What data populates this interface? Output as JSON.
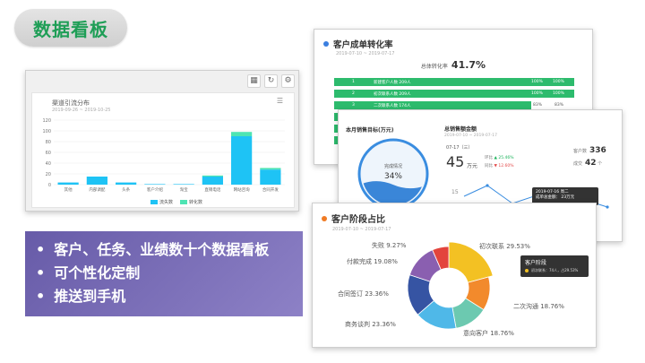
{
  "page_title": "数据看板",
  "bullets": [
    "客户、任务、业绩数十个数据看板",
    "可个性化定制",
    "推送到手机"
  ],
  "panel_channel": {
    "title": "渠道引流分布",
    "date": "2019-09-26 ~ 2019-10-25",
    "toolbar_icons": [
      "calendar-icon",
      "refresh-icon",
      "gear-icon"
    ],
    "legend": [
      "流失数",
      "转化数"
    ],
    "colors": {
      "loss": "#1ec3f5",
      "convert": "#4ee4b3"
    }
  },
  "panel_conversion": {
    "title": "客户成单转化率",
    "date": "2019-07-10 ~ 2019-07-17",
    "rate_label": "总体转化率",
    "rate_value": "41.7%",
    "accent": "#3a7fe0",
    "rows": [
      {
        "num": "1",
        "label": "新建客户人数 209人",
        "pct1": "100%",
        "pct2": "100%"
      },
      {
        "num": "2",
        "label": "初次联系人数 209人",
        "pct1": "100%",
        "pct2": "100%"
      },
      {
        "num": "3",
        "label": "二次联系人数 174人",
        "pct1": "83%",
        "pct2": "83%"
      }
    ]
  },
  "panel_sales": {
    "target_title": "本月销售目标(万元)",
    "total_title": "总销售额金额",
    "total_date": "2019-07-10 ~ 2019-07-17",
    "donut_label": "完成情况",
    "donut_value": "34%",
    "donut_fraction": 0.34,
    "date_label": "07-17（三）",
    "big_value": "45",
    "big_unit": "万元",
    "cmp_prev_label": "环比",
    "cmp_prev_value": "▲ 25.46%",
    "cmp_year_label": "同比",
    "cmp_year_value": "▼ 12.60%",
    "side1_label": "客户数",
    "side1_value": "336",
    "side2_label": "成交",
    "side2_value": "42",
    "side2_unit": "个",
    "y_ticks": [
      "15",
      "10",
      "5"
    ],
    "tip_date": "2019-07-16 周二",
    "tip_value": "成单总金额：  23万元"
  },
  "panel_stage": {
    "title": "客户阶段占比",
    "date": "2019-07-10 ~ 2019-07-17",
    "accent": "#f07b24",
    "tooltip_title": "客户阶段",
    "tooltip_sub": "初次联系：74人，占29.53%",
    "slices": [
      {
        "name": "初次联系",
        "pct": 29.53,
        "label": "初次联系 29.53%",
        "color": "#f3c123"
      },
      {
        "name": "二次沟通",
        "pct": 18.76,
        "label": "二次沟通 18.76%",
        "color": "#f28a2c"
      },
      {
        "name": "意向客户",
        "pct": 18.76,
        "label": "意向客户 18.76%",
        "color": "#6cc9b0"
      },
      {
        "name": "商务谈判",
        "pct": 23.36,
        "label": "商务谈判 23.36%",
        "color": "#4fb8e8"
      },
      {
        "name": "合同签订",
        "pct": 23.36,
        "label": "合同签订 23.36%",
        "color": "#3654a3"
      },
      {
        "name": "付款完成",
        "pct": 19.08,
        "label": "付款完成 19.08%",
        "color": "#8a5fb0"
      },
      {
        "name": "失败",
        "pct": 9.27,
        "label": "失败 9.27%",
        "color": "#e3443d"
      }
    ]
  },
  "chart_data": {
    "type": "bar",
    "title": "渠道引流分布",
    "categories": [
      "其他",
      "内部调配",
      "头条",
      "客户介绍",
      "淘宝",
      "直销电话",
      "网站咨询",
      "合同开发"
    ],
    "series": [
      {
        "name": "流失数",
        "values": [
          4,
          15,
          4,
          1,
          1,
          15,
          90,
          28
        ]
      },
      {
        "name": "转化数",
        "values": [
          0,
          0,
          0,
          0,
          0,
          2,
          8,
          3
        ]
      }
    ],
    "ylim": [
      0,
      120
    ],
    "yticks": [
      0,
      20,
      40,
      60,
      80,
      100,
      120
    ],
    "legend_position": "bottom",
    "grid": true
  }
}
